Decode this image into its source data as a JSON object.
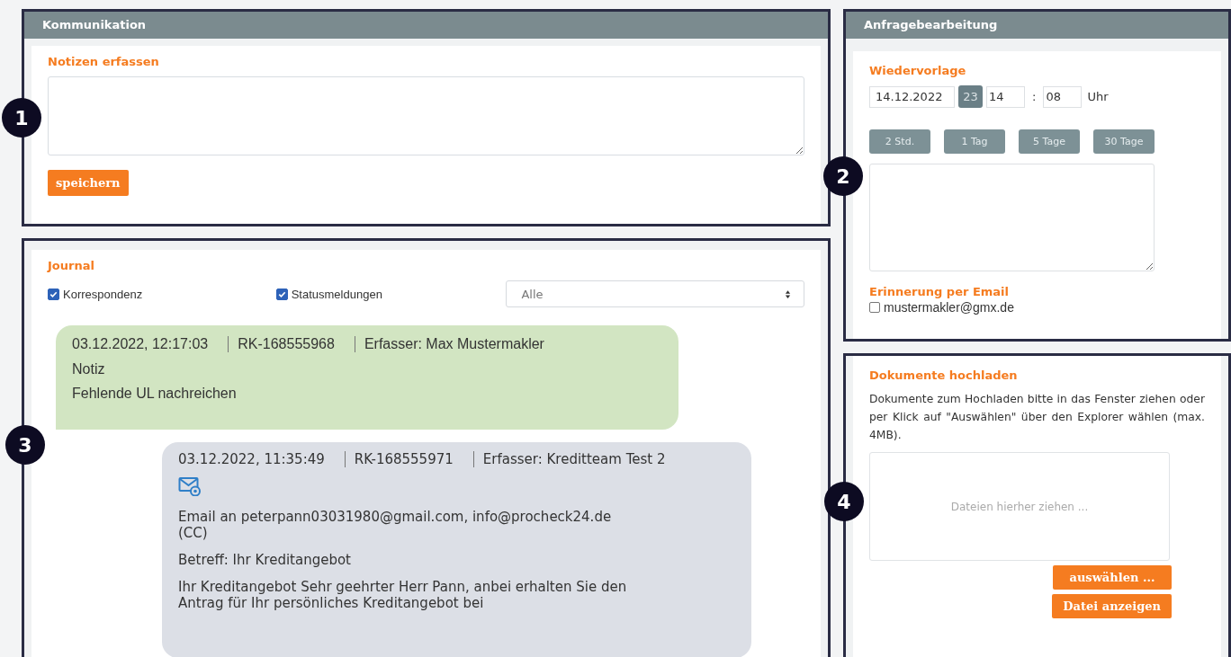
{
  "kommunikation": {
    "title": "Kommunikation",
    "notes_label": "Notizen erfassen",
    "save_button": "speichern"
  },
  "journal": {
    "title": "Journal",
    "filters": [
      {
        "label": "Korrespondenz",
        "checked": true
      },
      {
        "label": "Statusmeldungen",
        "checked": true
      }
    ],
    "select": "Alle",
    "entries": [
      {
        "kind": "note",
        "date": "03.12.2022, 12:17:03",
        "ref": "RK-168555968",
        "author_label": "Erfasser:",
        "author": "Max Mustermakler",
        "lines": [
          "Notiz",
          "Fehlende UL nachreichen"
        ]
      },
      {
        "kind": "email",
        "date": "03.12.2022, 11:35:49",
        "ref": "RK-168555971",
        "author_label": "Erfasser:",
        "author": "Kreditteam Test 2",
        "lines": [
          "Email an peterpann03031980@gmail.com, info@procheck24.de (CC)",
          "Betreff: Ihr Kreditangebot",
          "Ihr Kreditangebot  Sehr geehrter Herr Pann, anbei erhalten Sie den Antrag für Ihr persönliches Kreditangebot bei"
        ]
      }
    ]
  },
  "anfrage": {
    "title": "Anfragebearbeitung",
    "section": "Wiedervorlage",
    "date": "14.12.2022",
    "calendar_day": "23",
    "hour": "14",
    "separator": ":",
    "minute": "08",
    "unit": "Uhr",
    "quick_buttons": [
      "2 Std.",
      "1 Tag",
      "5 Tage",
      "30 Tage"
    ],
    "reminder_label": "Erinnerung per Email",
    "reminder": {
      "label": "mustermakler@gmx.de",
      "checked": false
    }
  },
  "upload": {
    "title": "Dokumente hochladen",
    "instructions": "Dokumente zum Hochladen bitte in das Fenster ziehen oder per Klick auf \"Auswählen\" über den Explorer wählen (max. 4MB).",
    "dropzone_placeholder": "Dateien hierher ziehen ...",
    "buttons": [
      "auswählen ...",
      "Datei anzeigen"
    ]
  },
  "markers": [
    "1",
    "2",
    "3",
    "4"
  ]
}
